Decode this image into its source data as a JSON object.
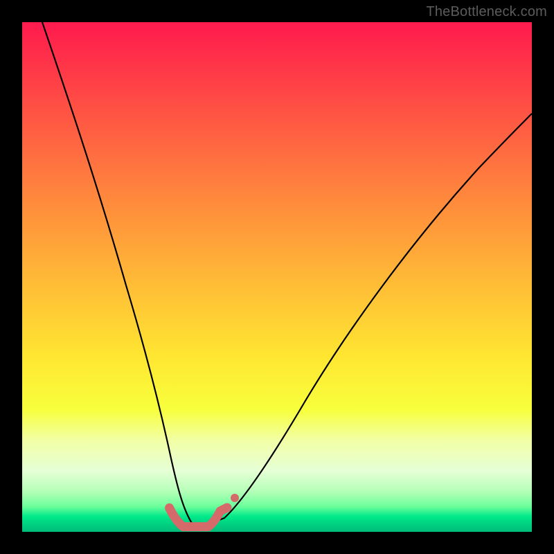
{
  "watermark": "TheBottleneck.com",
  "chart_data": {
    "type": "line",
    "title": "",
    "xlabel": "",
    "ylabel": "",
    "xlim": [
      0,
      100
    ],
    "ylim": [
      0,
      100
    ],
    "background_gradient": {
      "top_color": "#ff1a4e",
      "bottom_color": "#00bc7a",
      "note": "vertical gradient red→orange→yellow→green representing bottleneck severity, high=bad low=good"
    },
    "series": [
      {
        "name": "bottleneck-curve",
        "color": "#000000",
        "stroke_width": 2,
        "x": [
          4,
          8,
          12,
          16,
          20,
          23,
          26,
          28,
          30,
          31.5,
          33,
          35,
          37,
          40,
          45,
          52,
          60,
          70,
          82,
          95,
          100
        ],
        "values": [
          100,
          85,
          70,
          55,
          40,
          28,
          17,
          9,
          4,
          1.5,
          1,
          1,
          1.3,
          3,
          8,
          17,
          28,
          41,
          54,
          65,
          69
        ]
      },
      {
        "name": "optimal-range-marker",
        "color": "#d46a6a",
        "stroke_width": 12,
        "linecap": "round",
        "x": [
          28.9,
          30,
          31,
          31.6,
          32.5,
          34.5,
          36.5,
          37.2,
          37.9,
          38.8,
          40.2
        ],
        "values": [
          4.7,
          2.5,
          1.4,
          1.0,
          0.9,
          0.9,
          0.9,
          1.0,
          1.4,
          2.5,
          4.7
        ]
      },
      {
        "name": "marker-dot",
        "type": "scatter",
        "color": "#d46a6a",
        "radius": 6,
        "x": [
          41.7
        ],
        "values": [
          6.6
        ]
      }
    ]
  }
}
